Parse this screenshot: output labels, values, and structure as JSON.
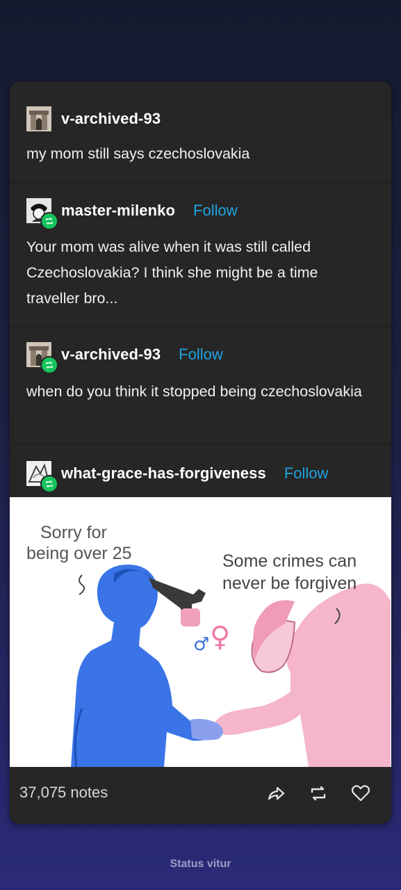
{
  "posts": [
    {
      "username": "v-archived-93",
      "follow": "",
      "text": "my mom still says czechoslovakia"
    },
    {
      "username": "master-milenko",
      "follow": "Follow",
      "text": "Your mom was alive when it was still called Czechoslovakia? I think she might be a time traveller bro..."
    },
    {
      "username": "v-archived-93",
      "follow": "Follow",
      "text": "when do you think it stopped being czechoslovakia"
    },
    {
      "username": "what-grace-has-forgiveness",
      "follow": "Follow"
    }
  ],
  "meme": {
    "left_caption_1": "Sorry for",
    "left_caption_2": "being over 25",
    "right_caption_1": "Some crimes can",
    "right_caption_2": "never be forgiven"
  },
  "footer": {
    "notes": "37,075 notes",
    "icons": [
      "share-icon",
      "reblog-icon",
      "heart-icon"
    ]
  },
  "status_text": "Status vitur",
  "colors": {
    "follow": "#1ea3e2",
    "reblog_badge": "#16c45e",
    "card": "#262626"
  }
}
